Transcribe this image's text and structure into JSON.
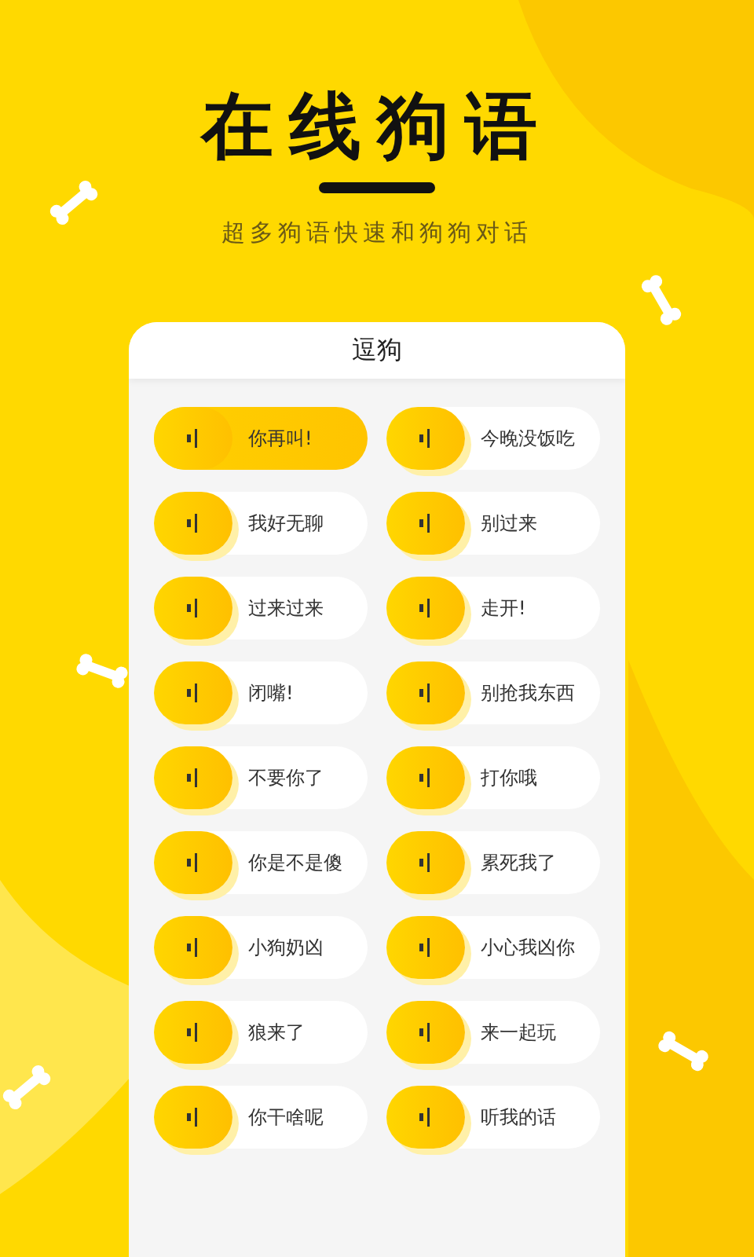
{
  "header": {
    "title": "在线狗语",
    "subtitle": "超多狗语快速和狗狗对话"
  },
  "card": {
    "title": "逗狗",
    "phrases": [
      {
        "text": "你再叫!",
        "selected": true
      },
      {
        "text": "今晚没饭吃",
        "selected": false
      },
      {
        "text": "我好无聊",
        "selected": false
      },
      {
        "text": "别过来",
        "selected": false
      },
      {
        "text": "过来过来",
        "selected": false
      },
      {
        "text": "走开!",
        "selected": false
      },
      {
        "text": "闭嘴!",
        "selected": false
      },
      {
        "text": "别抢我东西",
        "selected": false
      },
      {
        "text": "不要你了",
        "selected": false
      },
      {
        "text": "打你哦",
        "selected": false
      },
      {
        "text": "你是不是傻",
        "selected": false
      },
      {
        "text": "累死我了",
        "selected": false
      },
      {
        "text": "小狗奶凶",
        "selected": false
      },
      {
        "text": "小心我凶你",
        "selected": false
      },
      {
        "text": "狼来了",
        "selected": false
      },
      {
        "text": "来一起玩",
        "selected": false
      },
      {
        "text": "你干啥呢",
        "selected": false
      },
      {
        "text": "听我的话",
        "selected": false
      }
    ]
  }
}
